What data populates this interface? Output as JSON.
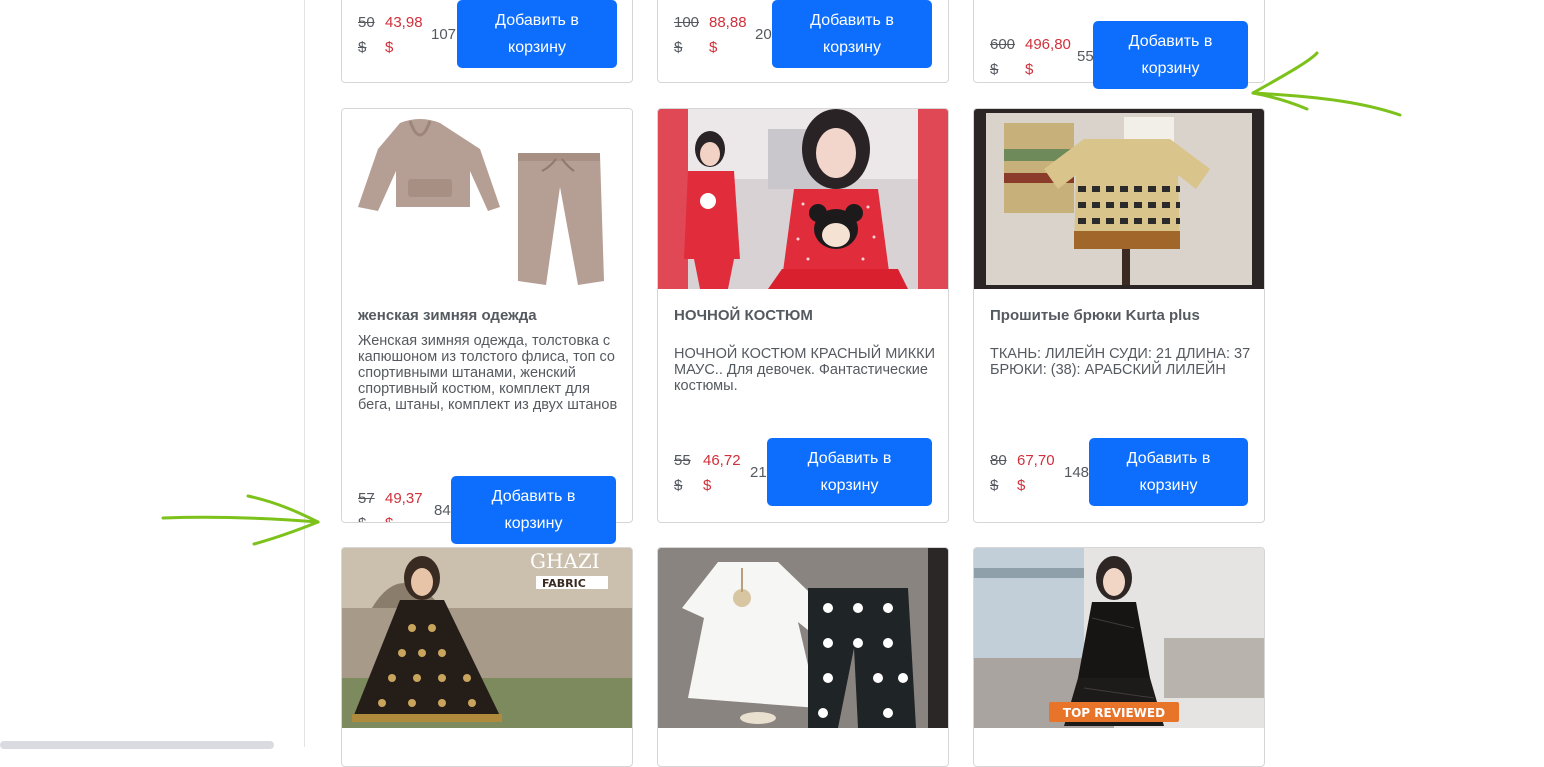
{
  "add_to_cart_label": "Добавить в корзину",
  "currency": "$",
  "top_row": [
    {
      "old_price": "50",
      "new_price": "43,98",
      "stock": "107"
    },
    {
      "old_price": "100",
      "new_price": "88,88",
      "stock": "20"
    },
    {
      "old_price": "600",
      "new_price": "496,80",
      "stock": "55"
    }
  ],
  "middle_row": [
    {
      "title": "женская зимняя одежда",
      "description": "Женская зимняя одежда, толстовка с капюшоном из толстого флиса, топ со спортивными штанами, женский спортивный костюм, комплект для бега, штаны, комплект из двух штанов",
      "old_price": "57",
      "new_price": "49,37",
      "stock": "84"
    },
    {
      "title": "НОЧНОЙ КОСТЮМ",
      "description": "НОЧНОЙ КОСТЮМ КРАСНЫЙ МИККИ МАУС.. Для девочек. Фантастические костюмы.",
      "old_price": "55",
      "new_price": "46,72",
      "stock": "21"
    },
    {
      "title": "Прошитые брюки Kurta plus",
      "description": "ТКАНЬ: ЛИЛЕЙН СУДИ: 21 ДЛИНА: 37 БРЮКИ: (38): АРАБСКИЙ ЛИЛЕЙН",
      "old_price": "80",
      "new_price": "67,70",
      "stock": "148"
    }
  ],
  "bottom_row": [
    {
      "image_text_1": "GHAZI",
      "image_text_2": "FABRIC"
    },
    {},
    {
      "image_text_1": "TOP REVIEWED"
    }
  ],
  "colors": {
    "button": "#0d6efd",
    "new_price": "#d0303b",
    "text": "#555a60",
    "annotation_arrow": "#7cc21a"
  }
}
